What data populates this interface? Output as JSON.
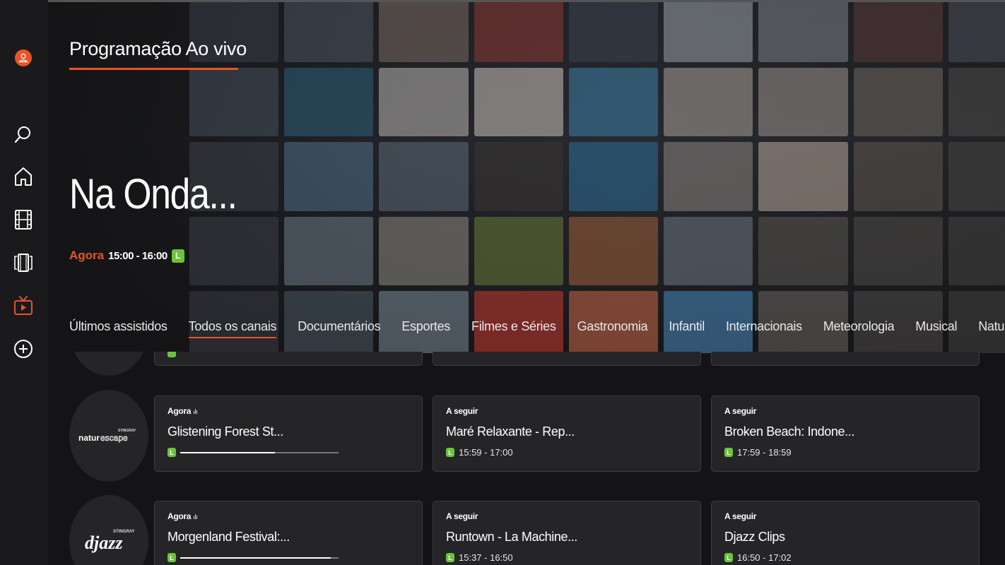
{
  "page_title": "Programação Ao vivo",
  "hero": {
    "show_title": "Na Onda...",
    "now_label": "Agora",
    "time_range": "15:00 - 16:00",
    "rating": "L"
  },
  "sidebar": {
    "items": [
      {
        "name": "profile",
        "icon": "user-icon"
      },
      {
        "name": "search",
        "icon": "search-icon"
      },
      {
        "name": "home",
        "icon": "home-icon"
      },
      {
        "name": "movies",
        "icon": "film-icon"
      },
      {
        "name": "series",
        "icon": "series-icon"
      },
      {
        "name": "live-tv",
        "icon": "tv-icon",
        "active": true
      },
      {
        "name": "add",
        "icon": "plus-circle-icon"
      }
    ]
  },
  "categories": [
    "Últimos assistidos",
    "Todos os canais",
    "Documentários",
    "Esportes",
    "Filmes e Séries",
    "Gastronomia",
    "Infantil",
    "Internacionais",
    "Meteorologia",
    "Musical",
    "Natur"
  ],
  "active_category": "Todos os canais",
  "channels": [
    {
      "logo": {
        "brand": "STINGRAY",
        "name": "naturescape"
      },
      "now": {
        "label": "Agora",
        "title": "Glistening Forest St...",
        "rating": "L",
        "progress": 0.6
      },
      "next1": {
        "label": "A seguir",
        "title": "Maré Relaxante - Rep...",
        "rating": "L",
        "time": "15:59 - 17:00"
      },
      "next2": {
        "label": "A seguir",
        "title": "Broken Beach: Indone...",
        "rating": "L",
        "time": "17:59 - 18:59"
      }
    },
    {
      "logo": {
        "brand": "STINGRAY",
        "name": "djazz"
      },
      "now": {
        "label": "Agora",
        "title": "Morgenland Festival:...",
        "rating": "L",
        "progress": 0.95
      },
      "next1": {
        "label": "A seguir",
        "title": "Runtown - La Machine...",
        "rating": "L",
        "time": "15:37 - 16:50"
      },
      "next2": {
        "label": "A seguir",
        "title": "Djazz Clips",
        "rating": "L",
        "time": "16:50 - 17:02"
      }
    }
  ],
  "colors": {
    "accent": "#e8542a",
    "rating_green": "#6ac43c",
    "card_bg": "#252528",
    "background": "#141416"
  }
}
